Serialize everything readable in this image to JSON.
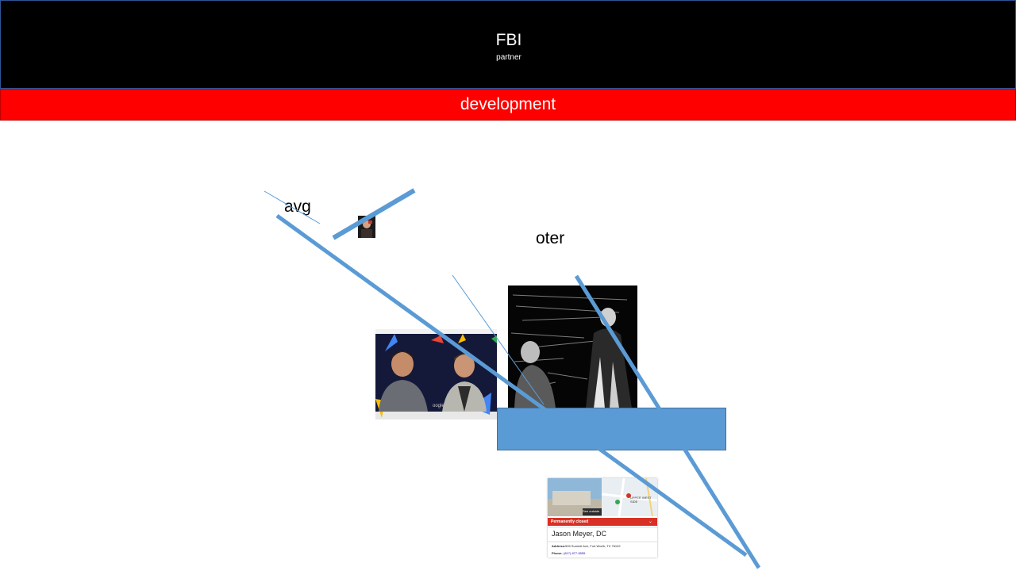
{
  "slide": {
    "title": "FBI",
    "subtitle": "partner",
    "band_text": "development",
    "labels": {
      "avg": "avg",
      "oter": "oter"
    }
  },
  "listing_card": {
    "badge": "Permanently closed",
    "name": "Jason Meyer, DC",
    "address_label": "Address:",
    "address": "905 Summit Ave, Fort Worth, TX 76102",
    "phone_label": "Phone:",
    "phone": "(817) 877-5555",
    "see_outside": "See outside",
    "map_text": "UPPER WEST SIDE"
  },
  "colors": {
    "header_bg": "#000000",
    "band_bg": "#ff0000",
    "shape_blue": "#5b9bd5",
    "text_white": "#ffffff"
  }
}
